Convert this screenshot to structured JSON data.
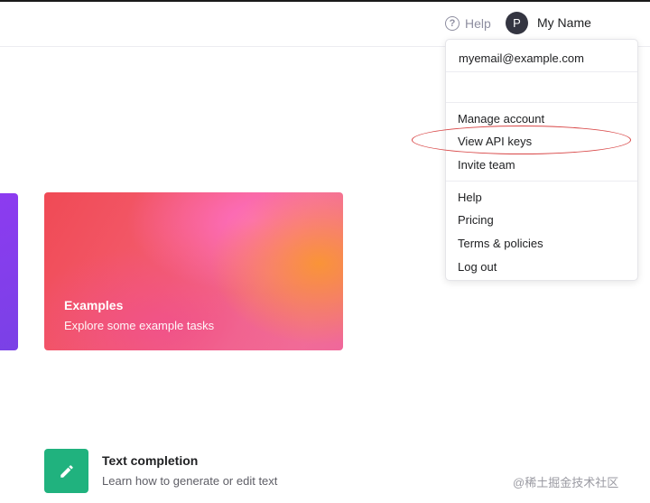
{
  "header": {
    "help_label": "Help",
    "help_icon": "question-circle-icon",
    "user": {
      "avatar_initial": "P",
      "name": "My Name"
    }
  },
  "user_menu": {
    "email": "myemail@example.com",
    "account_items": [
      "Manage account",
      "View API keys",
      "Invite team"
    ],
    "general_items": [
      "Help",
      "Pricing",
      "Terms & policies",
      "Log out"
    ],
    "highlighted_item": "View API keys",
    "highlight_color": "#d84545"
  },
  "cards": {
    "examples": {
      "title": "Examples",
      "subtitle": "Explore some example tasks"
    }
  },
  "guides": {
    "text_completion": {
      "title": "Text completion",
      "subtitle": "Learn how to generate or edit text",
      "icon": "pencil-icon",
      "icon_bg": "#20b27e"
    }
  },
  "watermark": "@稀土掘金技术社区"
}
